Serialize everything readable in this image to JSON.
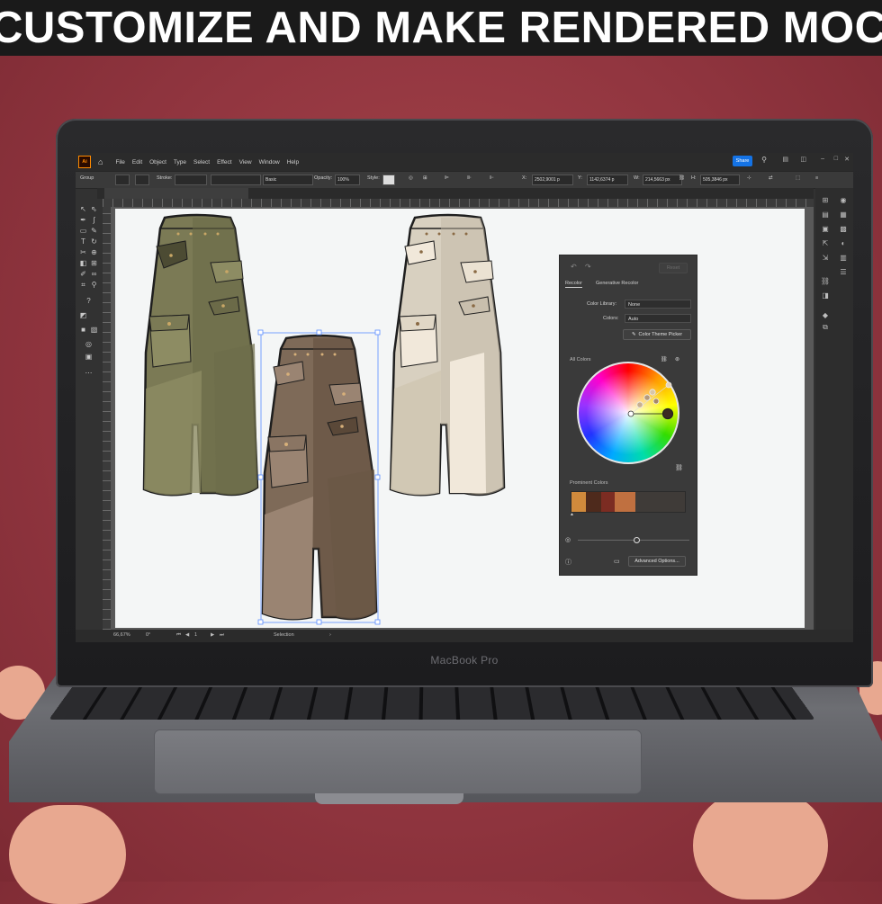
{
  "banner": {
    "text": "CUSTOMIZE AND MAKE RENDERED MOCKUP"
  },
  "laptop": {
    "brand": "MacBook Pro"
  },
  "menubar": {
    "app_icon": "Ai",
    "items": [
      "File",
      "Edit",
      "Object",
      "Type",
      "Select",
      "Effect",
      "View",
      "Window",
      "Help"
    ],
    "share_label": "Share"
  },
  "controlbar": {
    "selection": "Group",
    "stroke_label": "Stroke:",
    "brush_label": "Basic",
    "opacity_label": "Opacity:",
    "opacity_value": "100%",
    "style_label": "Style:",
    "x_label": "X:",
    "x_value": "2502,9001 p",
    "y_label": "Y:",
    "y_value": "1142,6374 p",
    "w_label": "W:",
    "w_value": "214,5663 px",
    "h_label": "H:",
    "h_value": "505,3846 px"
  },
  "statusbar": {
    "zoom": "66,67%",
    "rotation": "0°",
    "artboard": "1",
    "tool": "Selection"
  },
  "recolor_panel": {
    "tabs": [
      "Recolor",
      "Generative Recolor"
    ],
    "active_tab": "Recolor",
    "reset_label": "Reset",
    "color_library_label": "Color Library:",
    "color_library_value": "None",
    "colors_label": "Colors:",
    "colors_value": "Auto",
    "theme_picker_label": "Color Theme Picker",
    "all_colors_label": "All Colors",
    "prominent_colors_label": "Prominent Colors",
    "advanced_options_label": "Advanced Options...",
    "prominent_colors": [
      "#d08a3c",
      "#4e2a1c",
      "#7c2c22",
      "#c07040",
      "#3f3b38"
    ],
    "accent": "#1473e6"
  },
  "garments": {
    "olive": {
      "main": "#7b7a55",
      "dark": "#5e5d3e",
      "light": "#908f66"
    },
    "brown": {
      "main": "#7e6a58",
      "dark": "#5a4838",
      "light": "#9a8472"
    },
    "cream": {
      "main": "#d8d0c0",
      "dark": "#c2b8a6",
      "light": "#f1e8da"
    }
  },
  "colors": {
    "bg": "#a3404a",
    "ui_dark": "#323232",
    "artboard": "#f4f6f6"
  }
}
